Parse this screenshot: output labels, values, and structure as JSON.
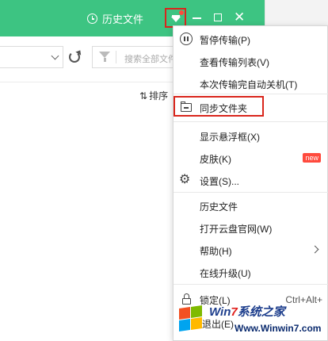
{
  "titlebar": {
    "history_tab": "历史文件"
  },
  "toolbar": {
    "search_placeholder": "搜索全部文件",
    "sort_label": "排序"
  },
  "menu": {
    "items": [
      {
        "label": "暂停传输(P)",
        "icon": "pause-icon"
      },
      {
        "label": "查看传输列表(V)"
      },
      {
        "label": "本次传输完自动关机(T)"
      },
      {
        "label": "同步文件夹",
        "icon": "folder-sync-icon",
        "highlighted": true
      },
      {
        "label": "显示悬浮框(X)"
      },
      {
        "label": "皮肤(K)",
        "badge": "new"
      },
      {
        "label": "设置(S)...",
        "icon": "gear-icon"
      },
      {
        "label": "历史文件"
      },
      {
        "label": "打开云盘官网(W)"
      },
      {
        "label": "帮助(H)",
        "submenu": true
      },
      {
        "label": "在线升级(U)"
      },
      {
        "label": "锁定(L)",
        "icon": "lock-icon",
        "shortcut": "Ctrl+Alt+"
      },
      {
        "label": "退出(E)"
      }
    ]
  },
  "watermark": {
    "title_prefix": "Win",
    "title_seven": "7",
    "title_suffix": "系统之家",
    "url": "Www.Winwin7.com"
  },
  "colors": {
    "titlebar": "#3dc482",
    "highlight_border": "#d9261c",
    "badge": "#ff4a3d"
  }
}
